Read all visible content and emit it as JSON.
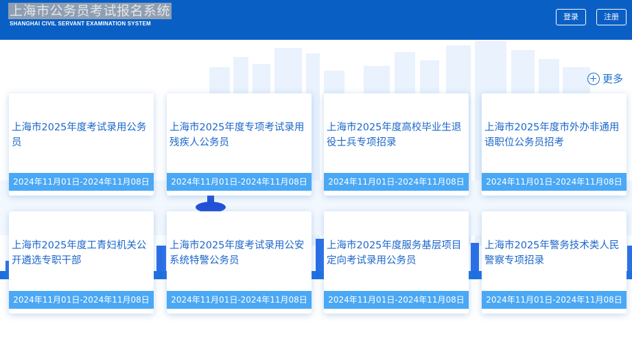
{
  "header": {
    "title": "上海市公务员考试报名系统",
    "subtitle": "SHANGHAI CIVIL SERVANT EXAMINATION SYSTEM",
    "login_label": "登录",
    "register_label": "注册",
    "bg_color": "#0a5fc4"
  },
  "main": {
    "more_label": "更多",
    "cards": [
      {
        "title": "上海市2025年度考试录用公务员",
        "date": "2024年11月01日-2024年11月08日"
      },
      {
        "title": "上海市2025年度专项考试录用残疾人公务员",
        "date": "2024年11月01日-2024年11月08日"
      },
      {
        "title": "上海市2025年度高校毕业生退役士兵专项招录",
        "date": "2024年11月01日-2024年11月08日"
      },
      {
        "title": "上海市2025年度市外办非通用语职位公务员招考",
        "date": "2024年11月01日-2024年11月08日"
      },
      {
        "title": "上海市2025年度工青妇机关公开遴选专职干部",
        "date": "2024年11月01日-2024年11月08日"
      },
      {
        "title": "上海市2025年度考试录用公安系统特警公务员",
        "date": "2024年11月01日-2024年11月08日"
      },
      {
        "title": "上海市2025年度服务基层项目定向考试录用公务员",
        "date": "2024年11月01日-2024年11月08日"
      },
      {
        "title": "上海市2025年警务技术类人民警察专项招录",
        "date": "2024年11月01日-2024年11月08日"
      }
    ]
  },
  "colors": {
    "accent": "#1b66c9",
    "date_bar": "#4aa8f5"
  }
}
